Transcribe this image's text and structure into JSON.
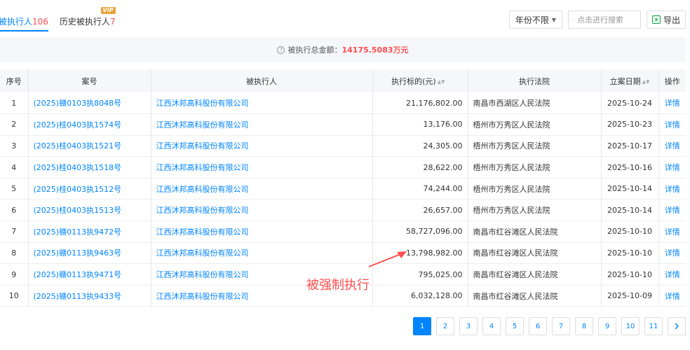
{
  "tabs": [
    {
      "label": "被执行人",
      "count": "106",
      "active": true
    },
    {
      "label": "历史被执行人",
      "count": "7",
      "badge": "VIP"
    }
  ],
  "toolbar": {
    "year_filter": "年份不限",
    "search_placeholder": "点击进行搜索",
    "export_label": "导出"
  },
  "summary": {
    "label": "被执行总金额：",
    "amount": "14175.5083万元"
  },
  "table": {
    "headers": [
      "序号",
      "案号",
      "被执行人",
      "执行标的(元)",
      "执行法院",
      "立案日期",
      "操作"
    ],
    "rows": [
      {
        "no": "1",
        "case": "(2025)赣0103执8048号",
        "party": "江西沐邦高科股份有限公司",
        "amount": "21,176,802.00",
        "court": "南昌市西湖区人民法院",
        "date": "2025-10-24",
        "action": "详情"
      },
      {
        "no": "2",
        "case": "(2025)桂0403执1574号",
        "party": "江西沐邦高科股份有限公司",
        "amount": "13,176.00",
        "court": "梧州市万秀区人民法院",
        "date": "2025-10-23",
        "action": "详情"
      },
      {
        "no": "3",
        "case": "(2025)桂0403执1521号",
        "party": "江西沐邦高科股份有限公司",
        "amount": "24,305.00",
        "court": "梧州市万秀区人民法院",
        "date": "2025-10-17",
        "action": "详情"
      },
      {
        "no": "4",
        "case": "(2025)桂0403执1518号",
        "party": "江西沐邦高科股份有限公司",
        "amount": "28,622.00",
        "court": "梧州市万秀区人民法院",
        "date": "2025-10-16",
        "action": "详情"
      },
      {
        "no": "5",
        "case": "(2025)桂0403执1512号",
        "party": "江西沐邦高科股份有限公司",
        "amount": "74,244.00",
        "court": "梧州市万秀区人民法院",
        "date": "2025-10-14",
        "action": "详情"
      },
      {
        "no": "6",
        "case": "(2025)桂0403执1513号",
        "party": "江西沐邦高科股份有限公司",
        "amount": "26,657.00",
        "court": "梧州市万秀区人民法院",
        "date": "2025-10-14",
        "action": "详情"
      },
      {
        "no": "7",
        "case": "(2025)赣0113执9472号",
        "party": "江西沐邦高科股份有限公司",
        "amount": "58,727,096.00",
        "court": "南昌市红谷滩区人民法院",
        "date": "2025-10-10",
        "action": "详情"
      },
      {
        "no": "8",
        "case": "(2025)赣0113执9463号",
        "party": "江西沐邦高科股份有限公司",
        "amount": "13,798,982.00",
        "court": "南昌市红谷滩区人民法院",
        "date": "2025-10-10",
        "action": "详情"
      },
      {
        "no": "9",
        "case": "(2025)赣0113执9471号",
        "party": "江西沐邦高科股份有限公司",
        "amount": "795,025.00",
        "court": "南昌市红谷滩区人民法院",
        "date": "2025-10-10",
        "action": "详情"
      },
      {
        "no": "10",
        "case": "(2025)赣0113执9433号",
        "party": "江西沐邦高科股份有限公司",
        "amount": "6,032,128.00",
        "court": "南昌市红谷滩区人民法院",
        "date": "2025-10-09",
        "action": "详情"
      }
    ]
  },
  "annotation": {
    "text": "被强制执行",
    "color": "#ff4d4f"
  },
  "pagination": {
    "pages": [
      "1",
      "2",
      "3",
      "4",
      "5",
      "6",
      "7",
      "8",
      "9",
      "10",
      "11"
    ],
    "current": "1",
    "next_icon": "chevron-right-icon"
  },
  "colors": {
    "accent": "#0084ff",
    "highlight": "#ff4d4f"
  }
}
